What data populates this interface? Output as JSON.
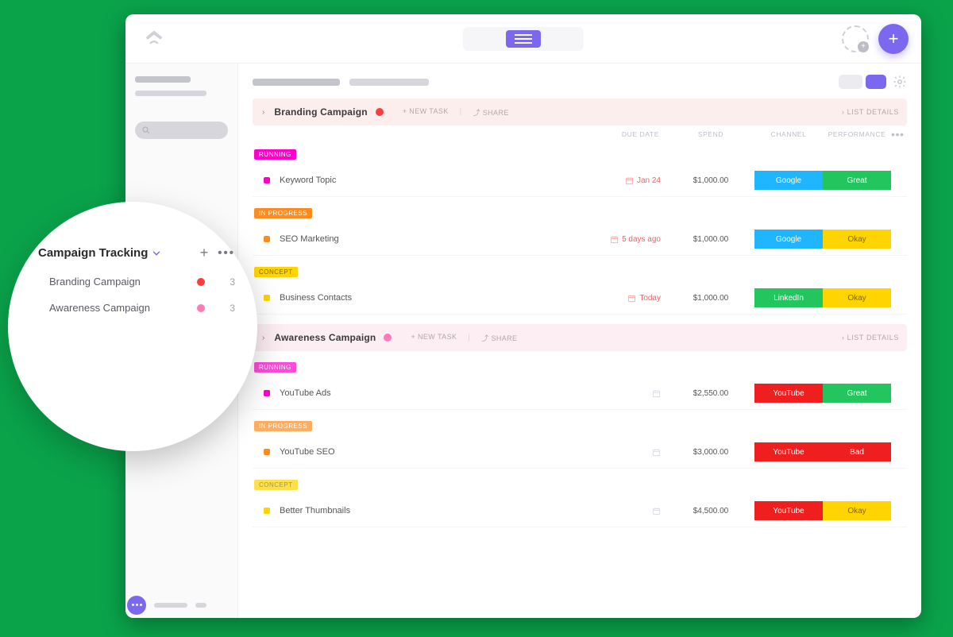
{
  "campaigns": [
    {
      "name": "Branding Campaign",
      "dot_color": "#ff3b3b",
      "header_bg": "red",
      "new_task_label": "+ NEW TASK",
      "share_label": "SHARE",
      "details_label": "LIST DETAILS",
      "columns": {
        "due": "DUE DATE",
        "spend": "SPEND",
        "channel": "CHANNEL",
        "perf": "PERFORMANCE"
      },
      "groups": [
        {
          "status": "RUNNING",
          "status_class": "st-running",
          "bullet": "b-running",
          "tasks": [
            {
              "name": "Keyword Topic",
              "due": "Jan 24",
              "due_class": "due-red",
              "spend": "$1,000.00",
              "channel": "Google",
              "channel_class": "c-google",
              "perf": "Great",
              "perf_class": "p-great"
            }
          ]
        },
        {
          "status": "IN PROGRESS",
          "status_class": "st-progress",
          "bullet": "b-progress",
          "tasks": [
            {
              "name": "SEO Marketing",
              "due": "5 days ago",
              "due_class": "due-red",
              "spend": "$1,000.00",
              "channel": "Google",
              "channel_class": "c-google",
              "perf": "Okay",
              "perf_class": "p-okay"
            }
          ]
        },
        {
          "status": "CONCEPT",
          "status_class": "st-concept",
          "bullet": "b-concept",
          "tasks": [
            {
              "name": "Business Contacts",
              "due": "Today",
              "due_class": "due-red",
              "spend": "$1,000.00",
              "channel": "LinkedIn",
              "channel_class": "c-linkedin",
              "perf": "Okay",
              "perf_class": "p-okay"
            }
          ]
        }
      ]
    },
    {
      "name": "Awareness Campaign",
      "dot_color": "#ff7ab8",
      "header_bg": "pink",
      "new_task_label": "+ NEW TASK",
      "share_label": "SHARE",
      "details_label": "LIST DETAILS",
      "groups": [
        {
          "status": "RUNNING",
          "status_class": "st-running",
          "bullet": "b-running",
          "status_light": true,
          "tasks": [
            {
              "name": "YouTube Ads",
              "due": "",
              "due_class": "",
              "spend": "$2,550.00",
              "channel": "YouTube",
              "channel_class": "c-youtube",
              "perf": "Great",
              "perf_class": "p-great"
            }
          ]
        },
        {
          "status": "IN PROGRESS",
          "status_class": "st-progress",
          "bullet": "b-progress",
          "status_light": true,
          "tasks": [
            {
              "name": "YouTube SEO",
              "due": "",
              "due_class": "",
              "spend": "$3,000.00",
              "channel": "YouTube",
              "channel_class": "c-youtube",
              "perf": "Bad",
              "perf_class": "p-bad"
            }
          ]
        },
        {
          "status": "CONCEPT",
          "status_class": "st-concept",
          "bullet": "b-concept",
          "status_light": true,
          "tasks": [
            {
              "name": "Better Thumbnails",
              "due": "",
              "due_class": "",
              "spend": "$4,500.00",
              "channel": "YouTube",
              "channel_class": "c-youtube",
              "perf": "Okay",
              "perf_class": "p-okay"
            }
          ]
        }
      ]
    }
  ],
  "popover": {
    "title": "Campaign Tracking",
    "items": [
      {
        "name": "Branding Campaign",
        "dot": "#ff3b3b",
        "count": "3"
      },
      {
        "name": "Awareness Campaign",
        "dot": "#ff7ab8",
        "count": "3"
      }
    ]
  },
  "icons": {
    "more": "•••"
  }
}
